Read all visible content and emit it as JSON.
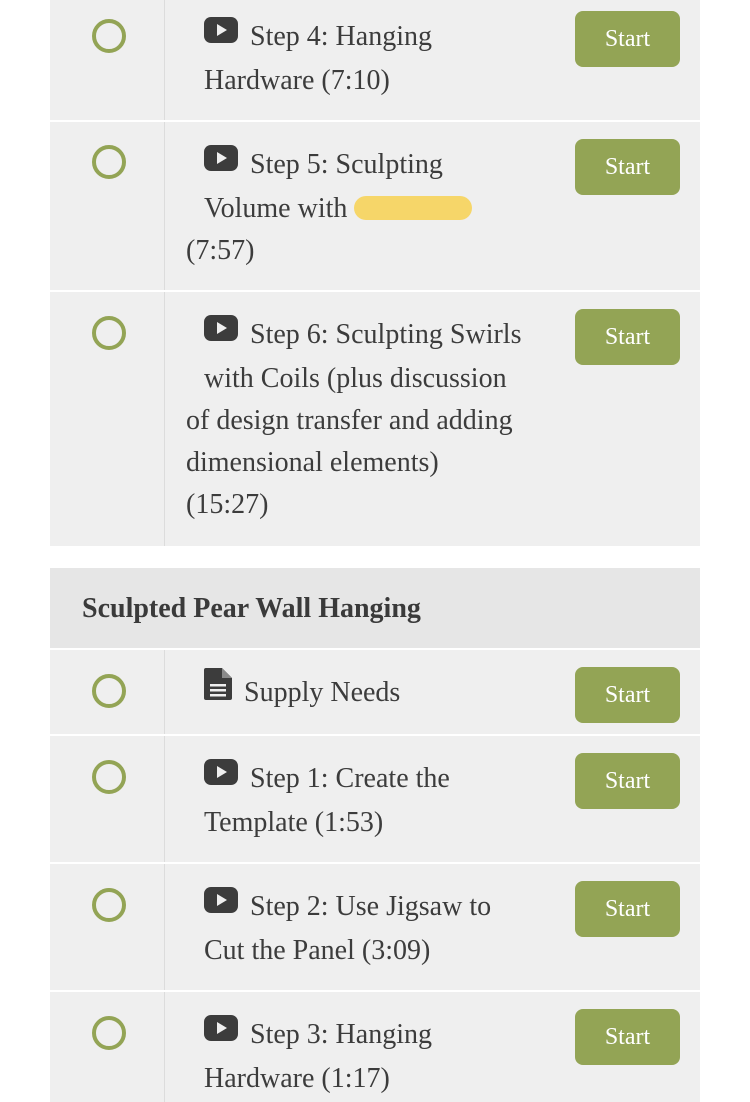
{
  "module_a": {
    "lessons": [
      {
        "icon": "play-icon",
        "text": "Step 4: Hanging Hardware (7:10)",
        "line1": "Step 4: Hanging",
        "line2": "Hardware (7:10)",
        "button": "Start"
      },
      {
        "icon": "play-icon",
        "line1": "Step 5: Sculpting",
        "line2": "Volume with",
        "line3": "(7:57)",
        "button": "Start"
      },
      {
        "icon": "play-icon",
        "line1": "Step 6: Sculpting Swirls",
        "line2": "with Coils (plus discussion",
        "line3": "of design transfer and adding",
        "line4": "dimensional elements)",
        "line5": "(15:27)",
        "button": "Start"
      }
    ]
  },
  "module_b": {
    "title": "Sculpted Pear Wall Hanging",
    "lessons": [
      {
        "icon": "document-icon",
        "line1": "Supply Needs",
        "button": "Start"
      },
      {
        "icon": "play-icon",
        "line1": "Step 1: Create the",
        "line2": "Template (1:53)",
        "button": "Start"
      },
      {
        "icon": "play-icon",
        "line1": "Step 2: Use Jigsaw to",
        "line2": "Cut the Panel (3:09)",
        "button": "Start"
      },
      {
        "icon": "play-icon",
        "line1": "Step 3: Hanging",
        "line2": "Hardware (1:17)",
        "button": "Start"
      }
    ]
  },
  "colors": {
    "accent": "#93a455",
    "row_bg": "#efefef",
    "header_bg": "#e6e6e6",
    "text": "#3c3c3c",
    "redaction": "#f6d35a"
  }
}
